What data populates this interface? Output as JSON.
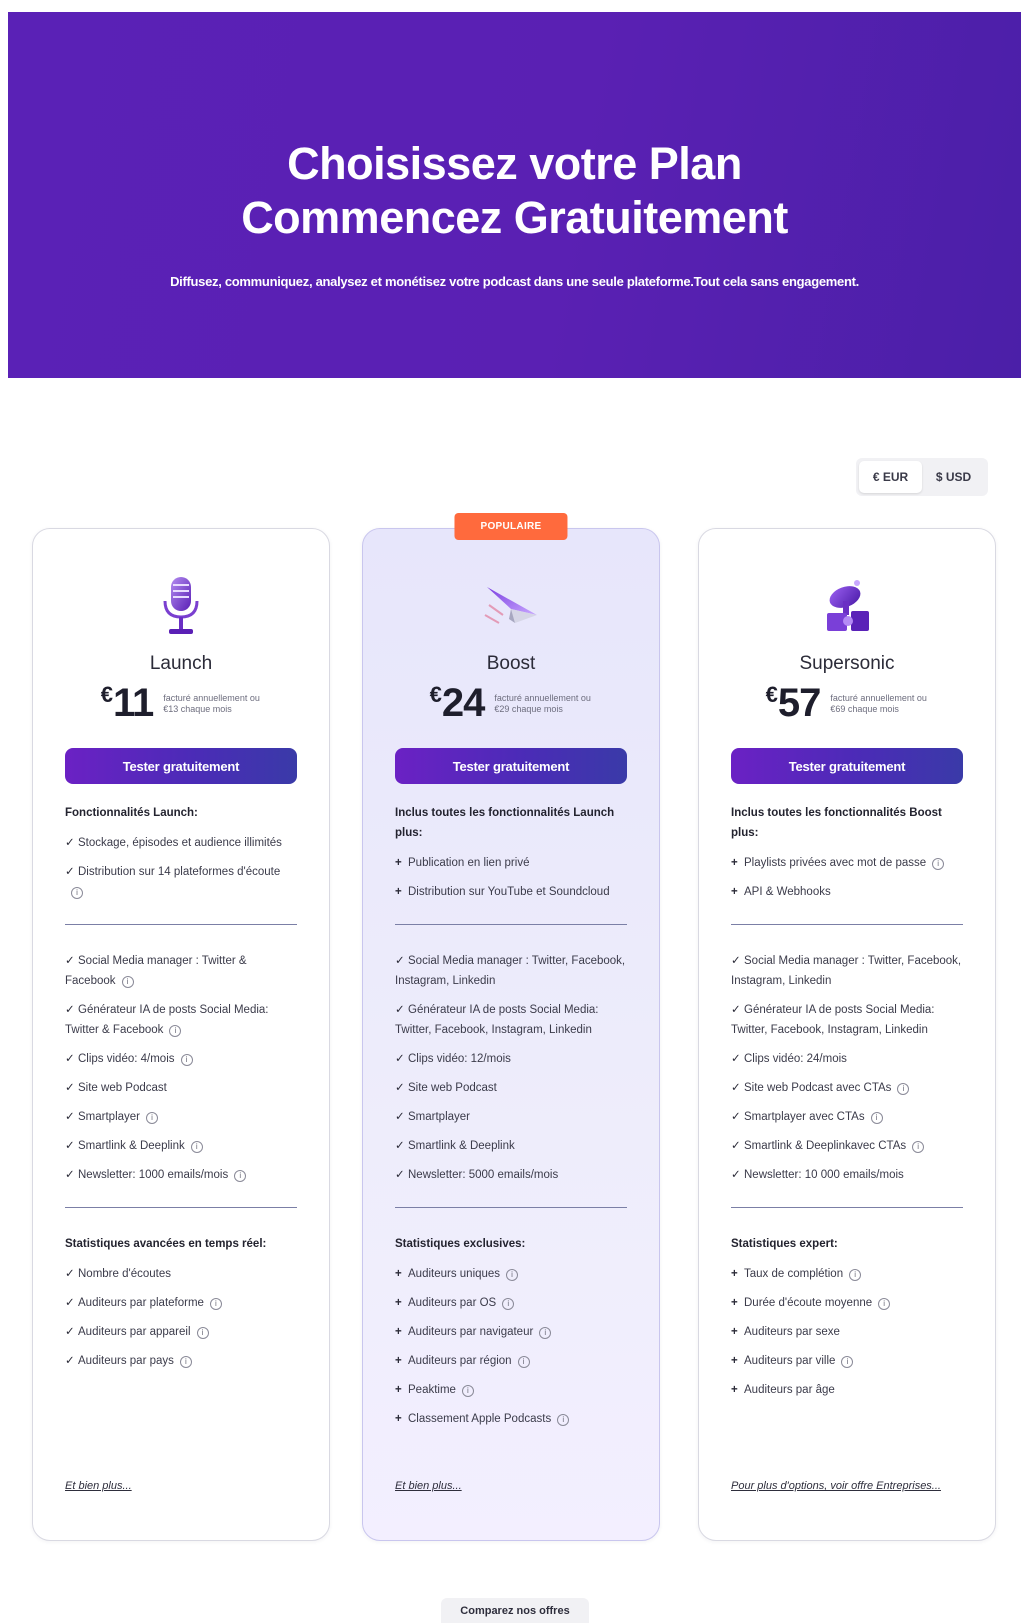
{
  "hero": {
    "title_line1": "Choisissez votre Plan",
    "title_line2": "Commencez Gratuitement",
    "subtitle": "Diffusez, communiquez, analysez et monétisez votre podcast dans une seule plateforme.Tout cela sans engagement."
  },
  "currency": {
    "options": [
      "€ EUR",
      "$ USD"
    ],
    "selected": "€ EUR"
  },
  "plans": [
    {
      "name": "Launch",
      "currency_symbol": "€",
      "price": "11",
      "billing": "facturé annuellement ou €13 chaque mois",
      "cta": "Tester gratuitement",
      "sections": [
        {
          "heading": "Fonctionnalités Launch:",
          "items": [
            {
              "text": "Stockage, épisodes et audience illimités",
              "mark": "✓",
              "info": false
            },
            {
              "text": "Distribution sur 14 plateformes d'écoute",
              "mark": "✓",
              "info": true
            }
          ]
        },
        {
          "heading": "",
          "items": [
            {
              "text": "Social Media manager : Twitter & Facebook",
              "mark": "✓",
              "info": true
            },
            {
              "text": "Générateur IA de posts Social Media: Twitter & Facebook",
              "mark": "✓",
              "info": true
            },
            {
              "text": "Clips vidéo: 4/mois",
              "mark": "✓",
              "info": true
            },
            {
              "text": "Site web Podcast",
              "mark": "✓",
              "info": false
            },
            {
              "text": "Smartplayer",
              "mark": "✓",
              "info": true
            },
            {
              "text": "Smartlink & Deeplink",
              "mark": "✓",
              "info": true
            },
            {
              "text": "Newsletter: 1000 emails/mois",
              "mark": "✓",
              "info": true
            }
          ]
        },
        {
          "heading": "Statistiques avancées en temps réel:",
          "items": [
            {
              "text": "Nombre d'écoutes",
              "mark": "✓",
              "info": false
            },
            {
              "text": "Auditeurs par plateforme",
              "mark": "✓",
              "info": true
            },
            {
              "text": "Auditeurs par appareil",
              "mark": "✓",
              "info": true
            },
            {
              "text": "Auditeurs par pays",
              "mark": "✓",
              "info": true
            }
          ]
        }
      ],
      "more_link": "Et bien plus..."
    },
    {
      "name": "Boost",
      "badge": "POPULAIRE",
      "currency_symbol": "€",
      "price": "24",
      "billing": "facturé annuellement ou €29 chaque mois",
      "cta": "Tester gratuitement",
      "sections": [
        {
          "heading": "Inclus toutes les fonctionnalités Launch plus:",
          "items": [
            {
              "text": "Publication en lien privé",
              "mark": "+",
              "info": false
            },
            {
              "text": "Distribution sur YouTube et Soundcloud",
              "mark": "+",
              "info": false
            }
          ]
        },
        {
          "heading": "",
          "items": [
            {
              "text": "Social Media manager : Twitter, Facebook, Instagram, Linkedin",
              "mark": "✓",
              "info": false
            },
            {
              "text": "Générateur IA de posts Social Media: Twitter, Facebook, Instagram, Linkedin",
              "mark": "✓",
              "info": false
            },
            {
              "text": "Clips vidéo: 12/mois",
              "mark": "✓",
              "info": false
            },
            {
              "text": "Site web Podcast",
              "mark": "✓",
              "info": false
            },
            {
              "text": "Smartplayer",
              "mark": "✓",
              "info": false
            },
            {
              "text": "Smartlink & Deeplink",
              "mark": "✓",
              "info": false
            },
            {
              "text": "Newsletter: 5000 emails/mois",
              "mark": "✓",
              "info": false
            }
          ]
        },
        {
          "heading": "Statistiques exclusives:",
          "items": [
            {
              "text": "Auditeurs uniques",
              "mark": "+",
              "info": true
            },
            {
              "text": "Auditeurs par OS",
              "mark": "+",
              "info": true
            },
            {
              "text": "Auditeurs par navigateur",
              "mark": "+",
              "info": true
            },
            {
              "text": "Auditeurs par région",
              "mark": "+",
              "info": true
            },
            {
              "text": "Peaktime",
              "mark": "+",
              "info": true
            },
            {
              "text": "Classement Apple Podcasts",
              "mark": "+",
              "info": true
            }
          ]
        }
      ],
      "more_link": "Et bien plus..."
    },
    {
      "name": "Supersonic",
      "currency_symbol": "€",
      "price": "57",
      "billing": "facturé annuellement ou €69 chaque mois",
      "cta": "Tester gratuitement",
      "sections": [
        {
          "heading": "Inclus toutes les fonctionnalités Boost plus:",
          "items": [
            {
              "text": "Playlists privées avec mot de passe",
              "mark": "+",
              "info": true
            },
            {
              "text": "API & Webhooks",
              "mark": "+",
              "info": false
            }
          ]
        },
        {
          "heading": "",
          "items": [
            {
              "text": "Social Media manager : Twitter, Facebook, Instagram, Linkedin",
              "mark": "✓",
              "info": false
            },
            {
              "text": "Générateur IA de posts Social Media: Twitter, Facebook, Instagram, Linkedin",
              "mark": "✓",
              "info": false
            },
            {
              "text": "Clips vidéo: 24/mois",
              "mark": "✓",
              "info": false
            },
            {
              "text": "Site web Podcast avec CTAs",
              "mark": "✓",
              "info": true
            },
            {
              "text": "Smartplayer avec CTAs",
              "mark": "✓",
              "info": true
            },
            {
              "text": "Smartlink & Deeplinkavec CTAs",
              "mark": "✓",
              "info": true
            },
            {
              "text": "Newsletter: 10 000 emails/mois",
              "mark": "✓",
              "info": false
            }
          ]
        },
        {
          "heading": "Statistiques expert:",
          "items": [
            {
              "text": "Taux de complétion",
              "mark": "+",
              "info": true
            },
            {
              "text": "Durée d'écoute moyenne",
              "mark": "+",
              "info": true
            },
            {
              "text": "Auditeurs par sexe",
              "mark": "+",
              "info": false
            },
            {
              "text": "Auditeurs par ville",
              "mark": "+",
              "info": true
            },
            {
              "text": "Auditeurs par âge",
              "mark": "+",
              "info": false
            }
          ]
        }
      ],
      "more_link": "Pour plus d'options, voir offre Entreprises..."
    }
  ],
  "compare_label": "Comparez nos offres",
  "colors": {
    "hero_bg": "#5a21b6",
    "cta_start": "#6b21c4",
    "cta_end": "#3a3aa8",
    "badge": "#ff6a3d",
    "featured_bg": "#e7e6fb"
  },
  "icons": {
    "launch": "microphone-icon",
    "boost": "paper-plane-icon",
    "supersonic": "satellite-icon",
    "info": "info-icon"
  }
}
